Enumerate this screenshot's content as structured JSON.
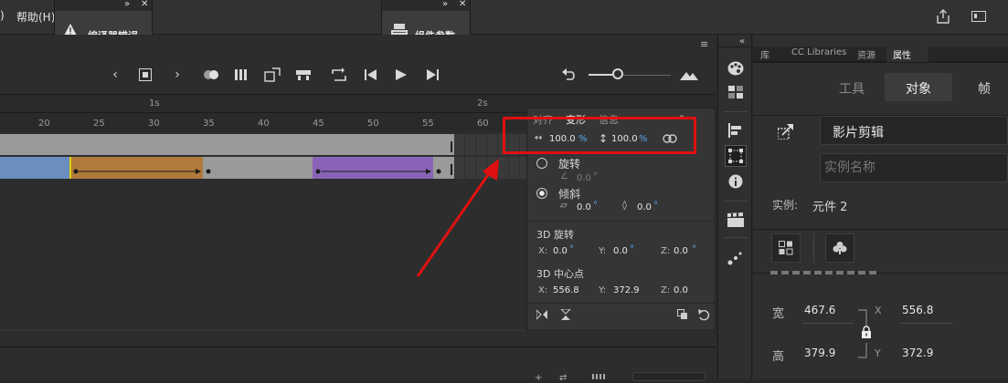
{
  "menu": {
    "paren": ")",
    "help": "帮助(H)"
  },
  "panels": {
    "compiler": {
      "label": "编译器错误",
      "expand": "»",
      "close": "✕"
    },
    "component": {
      "label": "组件参数",
      "expand": "»",
      "close": "✕"
    }
  },
  "ruler": {
    "sec_marks": [
      "1s",
      "2s"
    ],
    "frames": [
      "20",
      "25",
      "30",
      "35",
      "40",
      "45",
      "50",
      "55",
      "60"
    ]
  },
  "transform": {
    "tabs": [
      "对齐",
      "变形",
      "信息"
    ],
    "width_pct": "100.0",
    "height_pct": "100.0",
    "pct": "%",
    "rotate_label": "旋转",
    "rotate_val": "0.0",
    "skew_label": "倾斜",
    "skew_h": "0.0",
    "skew_v": "0.0",
    "deg": "°",
    "rot3d_label": "3D 旋转",
    "x_label": "X:",
    "y_label": "Y:",
    "z_label": "Z:",
    "rot3d_x": "0.0",
    "rot3d_y": "0.0",
    "rot3d_z": "0.0",
    "center3d_label": "3D 中心点",
    "center_x": "556.8",
    "center_y": "372.9",
    "center_z": "0.0"
  },
  "props": {
    "tabs": [
      "库",
      "CC Libraries",
      "资源",
      "属性"
    ],
    "active_tab": "属性",
    "subtabs": [
      "工具",
      "对象",
      "帧"
    ],
    "active_subtab": "对象",
    "symbol_type": "影片剪辑",
    "instance_placeholder": "实例名称",
    "instance_label": "实例:",
    "instance_value": "元件 2",
    "width_label": "宽",
    "height_label": "高",
    "width": "467.6",
    "height": "379.9",
    "x_label": "X",
    "y_label": "Y",
    "x": "556.8",
    "y": "372.9"
  },
  "colors": {
    "accent": "#5aa6f0",
    "tween_blue": "#6a8fbf",
    "tween_orange": "#b07a3c",
    "tween_purple": "#8a63b8",
    "annotation": "#e01010"
  }
}
